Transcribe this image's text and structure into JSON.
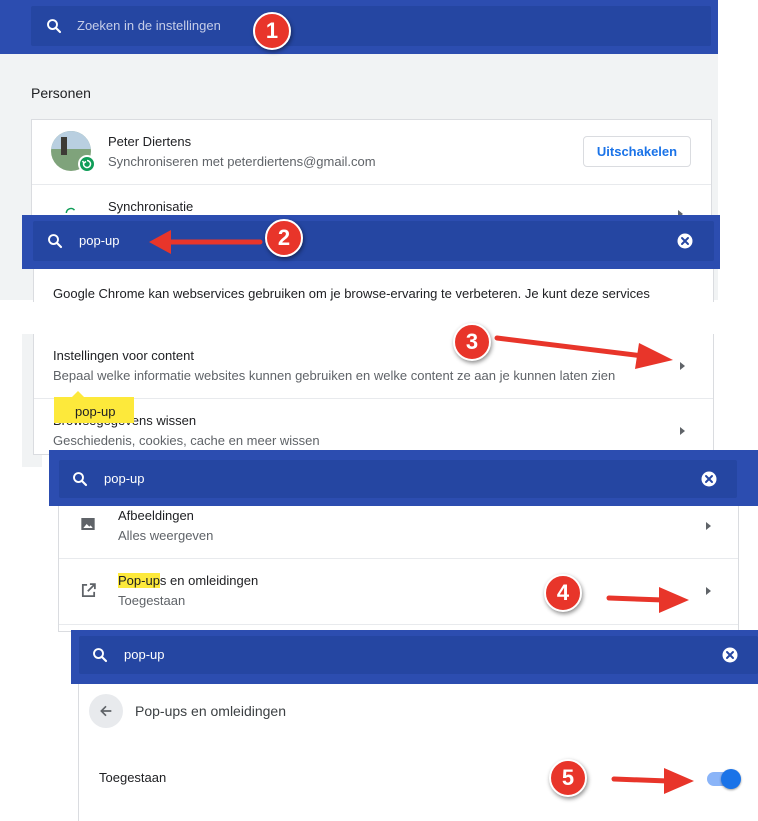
{
  "panel1": {
    "search_placeholder": "Zoeken in de instellingen",
    "section_title": "Personen",
    "profile_name": "Peter Diertens",
    "profile_sync": "Synchroniseren met peterdiertens@gmail.com",
    "disable_button": "Uitschakelen",
    "sync_label": "Synchronisatie"
  },
  "panel2": {
    "search_value": "pop-up",
    "services_text": "Google Chrome kan webservices gebruiken om je browse-ervaring te verbeteren. Je kunt deze services"
  },
  "panel3": {
    "content_title": "Instellingen voor content",
    "content_sub": "Bepaal welke informatie websites kunnen gebruiken en welke content ze aan je kunnen laten zien",
    "tooltip": "pop-up",
    "clear_title": "Browsegegevens wissen",
    "clear_sub": "Geschiedenis, cookies, cache en meer wissen"
  },
  "panel4": {
    "search_value": "pop-up",
    "images_title": "Afbeeldingen",
    "images_sub": "Alles weergeven",
    "popups_title_hl": "Pop-up",
    "popups_title_rest": "s en omleidingen",
    "popups_sub": "Toegestaan"
  },
  "panel5": {
    "search_value": "pop-up",
    "page_title": "Pop-ups en omleidingen",
    "toggle_label": "Toegestaan",
    "toggle_on": true
  },
  "badges": [
    "1",
    "2",
    "3",
    "4",
    "5"
  ],
  "colors": {
    "header_blue": "#2c4db0",
    "field_blue": "#2546a2",
    "badge_red": "#e8352a",
    "toggle_blue": "#1a73e8",
    "highlight": "#fde93b"
  }
}
